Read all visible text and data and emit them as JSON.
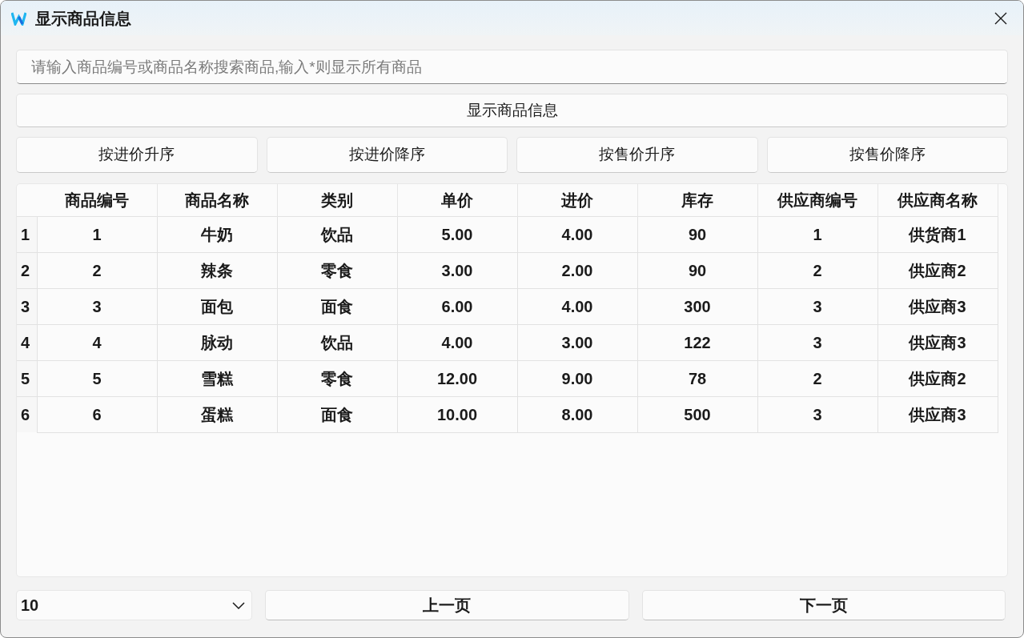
{
  "window": {
    "title": "显示商品信息"
  },
  "search": {
    "placeholder": "请输入商品编号或商品名称搜索商品,输入*则显示所有商品"
  },
  "show_button": "显示商品信息",
  "sort_buttons": [
    "按进价升序",
    "按进价降序",
    "按售价升序",
    "按售价降序"
  ],
  "table": {
    "columns": [
      "商品编号",
      "商品名称",
      "类别",
      "单价",
      "进价",
      "库存",
      "供应商编号",
      "供应商名称"
    ],
    "rows": [
      {
        "row_number": "1",
        "cells": [
          "1",
          "牛奶",
          "饮品",
          "5.00",
          "4.00",
          "90",
          "1",
          "供货商1"
        ]
      },
      {
        "row_number": "2",
        "cells": [
          "2",
          "辣条",
          "零食",
          "3.00",
          "2.00",
          "90",
          "2",
          "供应商2"
        ]
      },
      {
        "row_number": "3",
        "cells": [
          "3",
          "面包",
          "面食",
          "6.00",
          "4.00",
          "300",
          "3",
          "供应商3"
        ]
      },
      {
        "row_number": "4",
        "cells": [
          "4",
          "脉动",
          "饮品",
          "4.00",
          "3.00",
          "122",
          "3",
          "供应商3"
        ]
      },
      {
        "row_number": "5",
        "cells": [
          "5",
          "雪糕",
          "零食",
          "12.00",
          "9.00",
          "78",
          "2",
          "供应商2"
        ]
      },
      {
        "row_number": "6",
        "cells": [
          "6",
          "蛋糕",
          "面食",
          "10.00",
          "8.00",
          "500",
          "3",
          "供应商3"
        ]
      }
    ]
  },
  "pagination": {
    "page_size": "10",
    "buttons": [
      "上一页",
      "下一页"
    ]
  }
}
